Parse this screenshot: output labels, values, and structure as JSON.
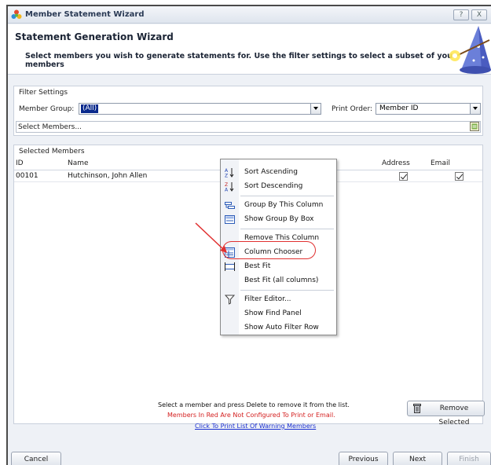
{
  "window": {
    "title": "Member Statement Wizard",
    "help_label": "?",
    "close_label": "X"
  },
  "header": {
    "title": "Statement Generation Wizard",
    "subtitle": "Select members you wish to generate statements for. Use the filter settings to select a subset of your members"
  },
  "filter": {
    "group_title": "Filter Settings",
    "member_group_label": "Member Group:",
    "member_group_value": "(All)",
    "print_order_label": "Print Order:",
    "print_order_value": "Member ID",
    "select_members_label": "Select Members..."
  },
  "selected": {
    "group_title": "Selected Members",
    "columns": {
      "id": "ID",
      "name": "Name",
      "address": "Address",
      "email": "Email"
    },
    "rows": [
      {
        "id": "00101",
        "name": "Hutchinson, John Allen",
        "address": true,
        "email": true
      }
    ]
  },
  "context_menu": {
    "items": [
      {
        "label": "Sort Ascending",
        "icon": "sort-ascending-icon"
      },
      {
        "label": "Sort Descending",
        "icon": "sort-descending-icon"
      },
      {
        "label": "Group By This Column",
        "icon": "group-by-icon"
      },
      {
        "label": "Show Group By Box",
        "icon": "group-box-icon"
      },
      {
        "label": "Remove This Column",
        "icon": ""
      },
      {
        "label": "Column Chooser",
        "icon": "column-chooser-icon"
      },
      {
        "label": "Best Fit",
        "icon": "best-fit-icon"
      },
      {
        "label": "Best Fit (all columns)",
        "icon": ""
      },
      {
        "label": "Filter Editor...",
        "icon": "filter-icon"
      },
      {
        "label": "Show Find Panel",
        "icon": ""
      },
      {
        "label": "Show Auto Filter Row",
        "icon": ""
      }
    ]
  },
  "footer": {
    "hint": "Select a member and press Delete to remove it from the list.",
    "warning": "Members In Red Are Not Configured To Print or Email.",
    "link": "Click To Print List Of Warning Members",
    "remove_selected": "Remove Selected",
    "warning_color": "#d42020",
    "link_color": "#1a2fd0"
  },
  "buttons": {
    "cancel": "Cancel",
    "previous": "Previous",
    "next": "Next",
    "finish": "Finish"
  }
}
